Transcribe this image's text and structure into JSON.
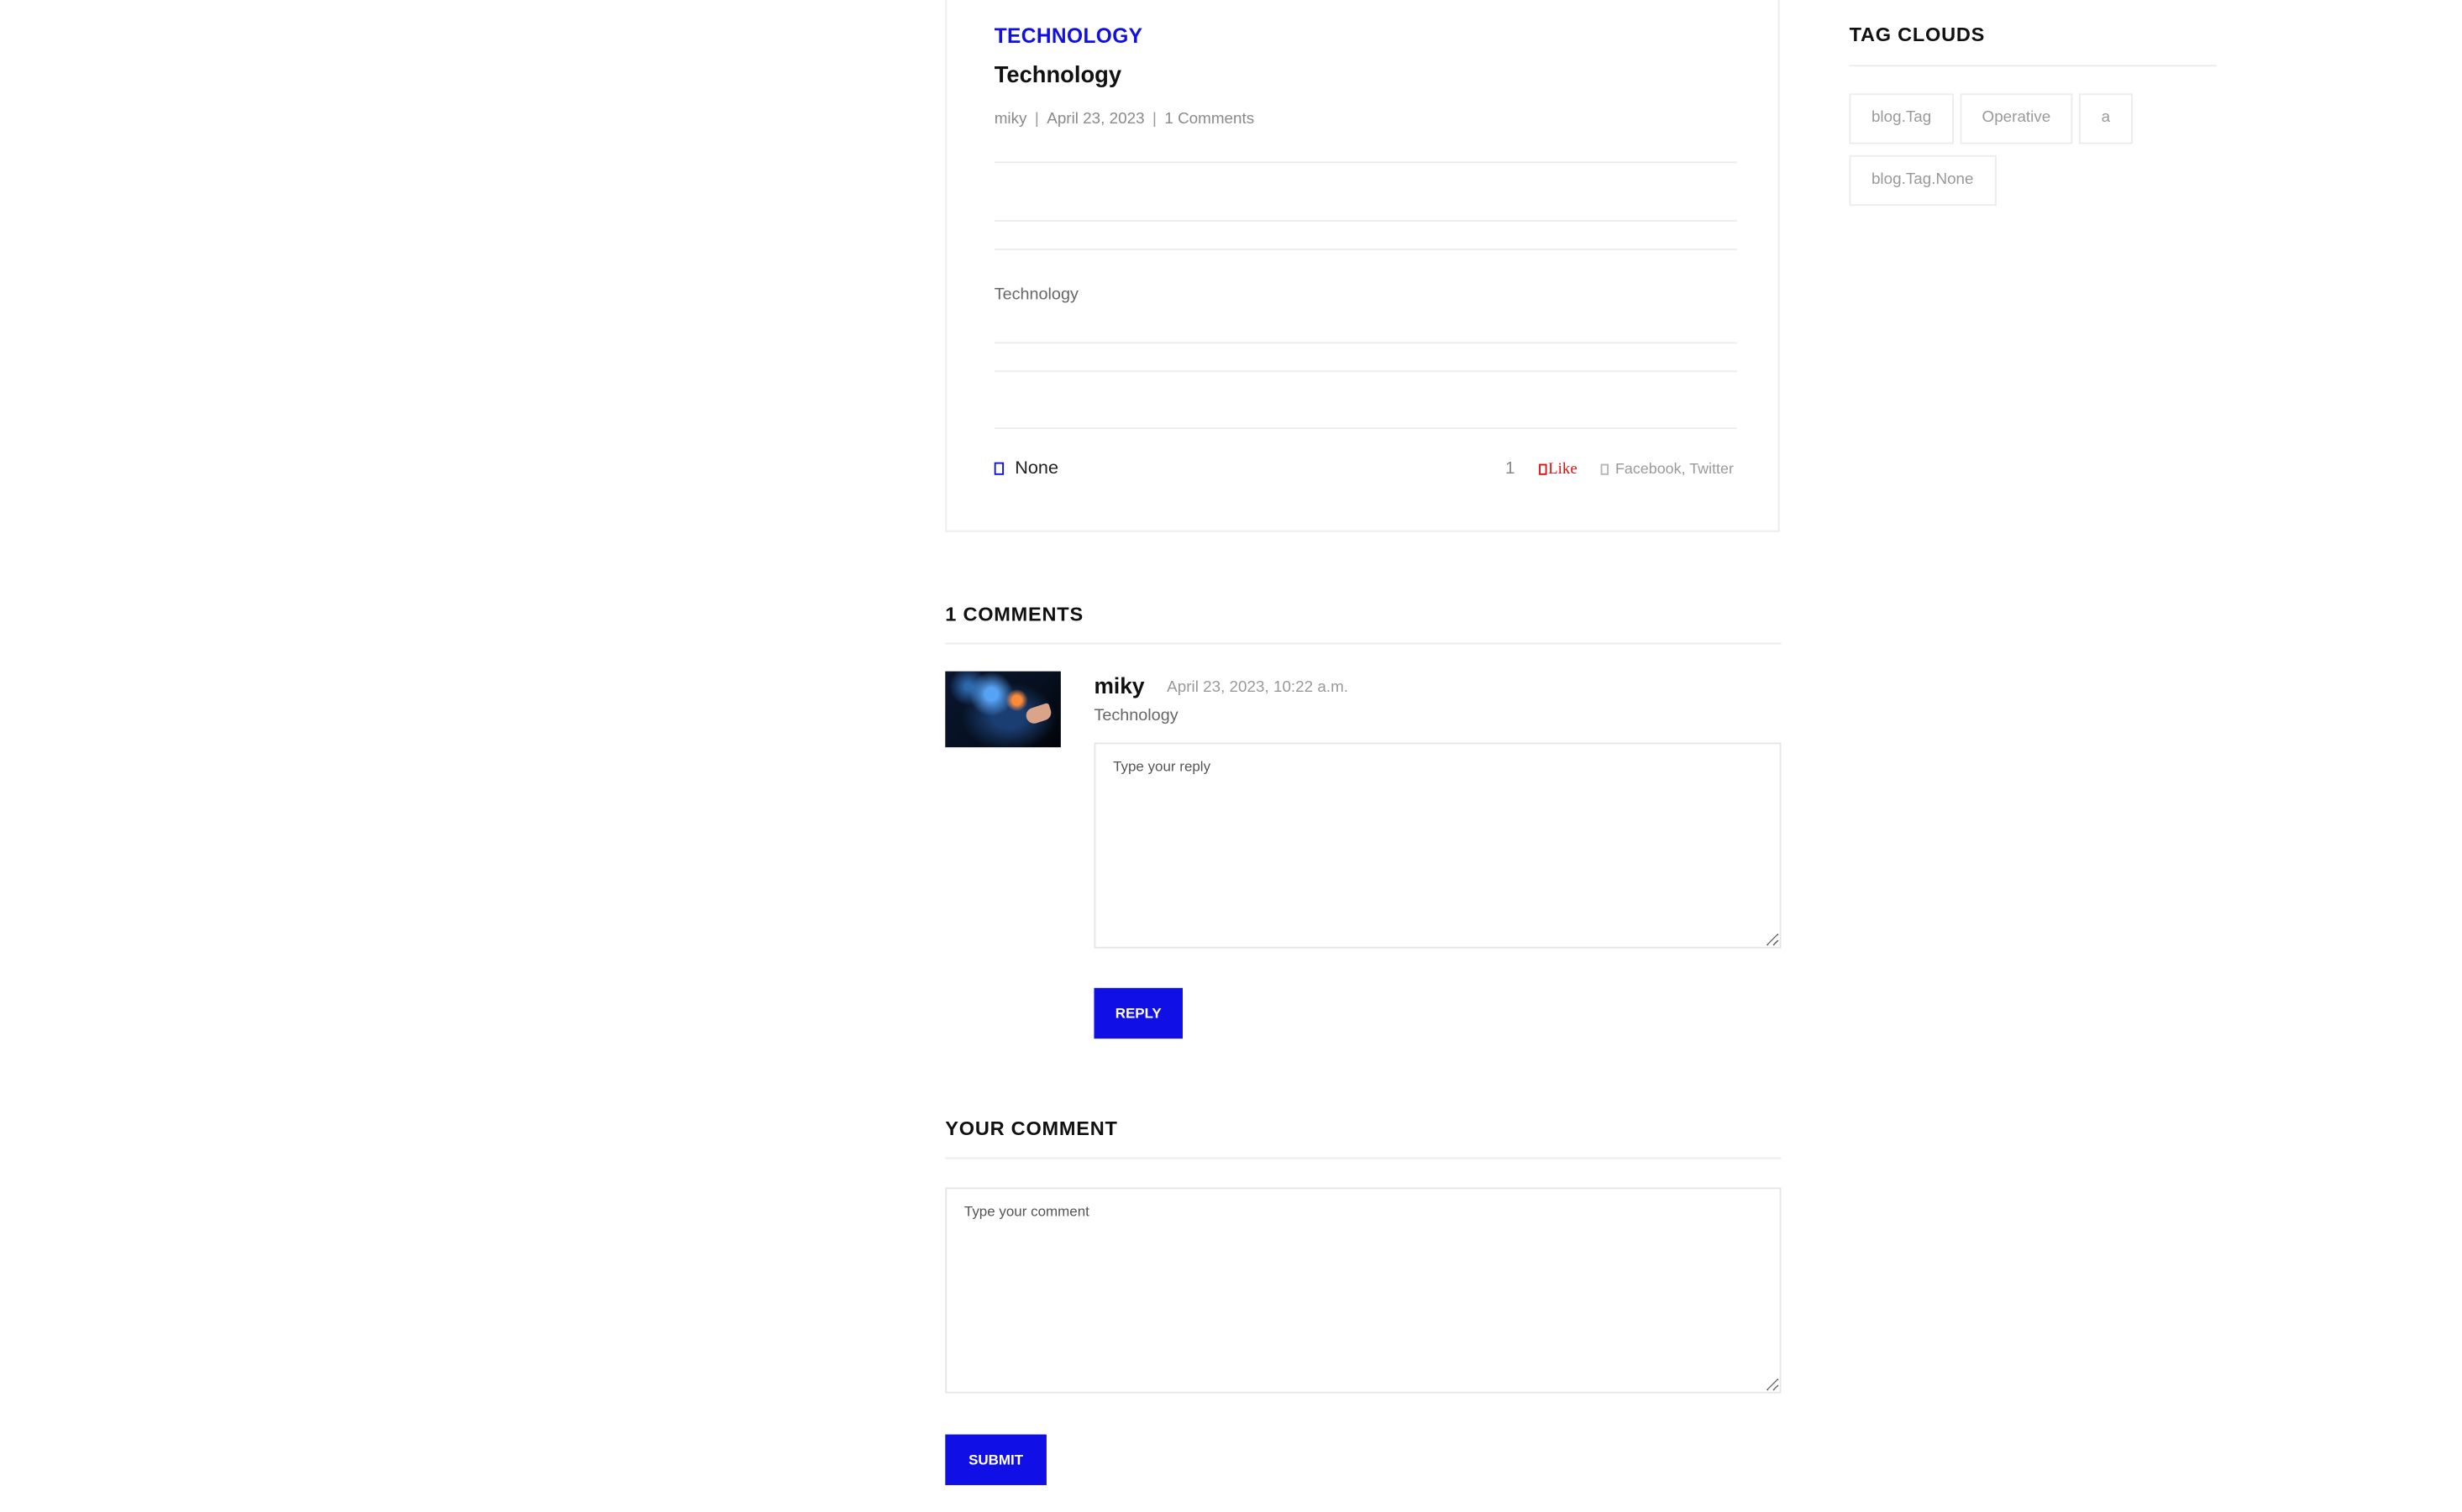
{
  "article": {
    "category": "TECHNOLOGY",
    "title": "Technology",
    "meta": {
      "author": "miky",
      "date": "April 23, 2023",
      "comments": "1 Comments"
    },
    "body": "Technology",
    "tags_label": "None",
    "like_count": "1",
    "like_label": "Like",
    "share_text": "Facebook, Twitter"
  },
  "comments_section": {
    "heading": "1 COMMENTS",
    "comments": [
      {
        "author": "miky",
        "date": "April 23, 2023, 10:22 a.m.",
        "text": "Technology"
      }
    ],
    "reply_placeholder": "Type your reply",
    "reply_button": "REPLY"
  },
  "your_comment": {
    "heading": "YOUR COMMENT",
    "placeholder": "Type your comment",
    "submit_button": "SUBMIT"
  },
  "sidebar": {
    "heading": "TAG CLOUDS",
    "tags": [
      "blog.Tag",
      "Operative",
      "a",
      "blog.Tag.None"
    ]
  },
  "colors": {
    "accent": "#1010e6",
    "like": "#e01010"
  }
}
